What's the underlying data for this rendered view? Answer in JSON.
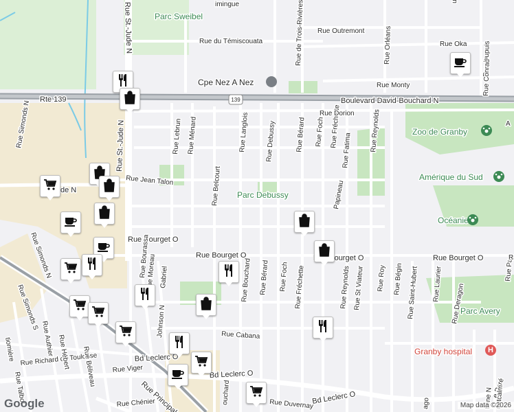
{
  "map": {
    "shields": {
      "route": "139"
    },
    "streets": {
      "rte_139": "Rte 139",
      "boulevard_david_bouchard": "Boulevard David-Bouchard N",
      "rue_bourget_o_left": "Rue Bourget O",
      "rue_bourget_o_mid": "Rue Bourget O",
      "rue_bourget_o_right": "Rue Bourget O",
      "rue_jean_talon": "Rue Jean Talon",
      "rue_cabana": "Rue Cabana",
      "bd_leclerc_o_left": "Bd Leclerc O",
      "bd_leclerc_o_right": "Bd Leclerc O",
      "rue_principale": "Rue Principale",
      "rue_duvernay": "Rue Duvernay",
      "rue_chenier": "Rue Chénier",
      "rue_viger": "Rue Viger",
      "rue_richard_de_toulouse": "Rue Richard de Toulouse",
      "rue_talbot": "Rue Talbot",
      "rue_belouveau": "Rue Béliveau",
      "rue_hebert": "Rue Hébert",
      "rue_authier": "Rue Authier",
      "rue_simonds_n": "Rue Simonds N",
      "rue_simonds_s": "Rue Simonds S",
      "rue_st_jude": "Rue St.-Jude N",
      "rue_st_jude_top": "Rue St.-Jude N",
      "rue_lebrun": "Rue Lebrun",
      "rue_menard": "Rue Ménard",
      "rue_belcourt": "Rue Belcourt",
      "rue_langlois": "Rue Langlois",
      "rue_debussy": "Rue Debussy",
      "rue_berard_top": "Rue Bérard",
      "rue_foch_top": "Rue Foch",
      "rue_frechette_top": "Rue Fréchette",
      "rue_fatima": "Rue Fatima",
      "rue_reynolds_top": "Rue Reynolds",
      "rue_papineau": "Papineau",
      "rue_bouchard": "Rue Bouchard",
      "rue_berard": "Rue Bérard",
      "rue_foch": "Rue Foch",
      "rue_frechette": "Rue Fréchette",
      "rue_reynolds": "Rue Reynolds",
      "rue_st_viateur": "Rue St Viateur",
      "rue_roy": "Rue Roy",
      "rue_begin": "Rue Bégin",
      "rue_saint_hubert": "Rue Saint-Hubert",
      "rue_laurier": "Rue Laurier",
      "rue_deragon": "Rue Deragon",
      "rue_bourassa": "Rue Bourassa",
      "rue_moreau": "Rue Moreau",
      "rue_gabriel": "Gabriel",
      "rue_johnson": "Johnson N",
      "rue_du_temiscouata": "Rue du Témiscouata",
      "rue_outremont": "Rue Outremont",
      "rue_oka": "Rue Oka",
      "rue_monty": "Rue Monty",
      "rue_dorion": "Rue Dorion",
      "rue_de_trois_rivieres": "Rue de Trois-Rivières",
      "rue_orleans": "Rue Orléans",
      "rue_dupuis": "Rue Dupuis",
      "rue_conrad": "Rue Conrad",
      "rue_pare": "e Paré",
      "rue_montcalm": "ontcalm",
      "rue_antoine": "toine N",
      "rue_pa": "Rue Pa",
      "rue_tiomiere": "tiomière",
      "rue_fragment_ue": "ue",
      "rue_fragment_a": "A",
      "rue_fragment_dimingue": "imingue",
      "rue_fragment_n": "N",
      "rue_fragment_de_n": "de N",
      "rue_fragment_ago": "ago",
      "rue_fragment_ra": "Ra",
      "rue_chouard": "ouchard",
      "rue_simonds_top": "Rue Simonds N"
    },
    "places": {
      "parc_sweibel": "Parc Sweibel",
      "parc_debussy": "Parc Debussy",
      "parc_avery": "Parc Avery",
      "cpe_nez_a_nez": "Cpe Nez A Nez",
      "zoo_de_granby": "Zoo de Granby",
      "amerique_du_sud": "Amérique du Sud",
      "oceanie": "Océanie",
      "granby_hospital": "Granby hospital"
    },
    "pins": [
      {
        "icon": "restaurant-icon"
      },
      {
        "icon": "shopping-bag-icon"
      },
      {
        "icon": "shopping-bag-icon"
      },
      {
        "icon": "shopping-cart-icon"
      },
      {
        "icon": "shopping-bag-icon"
      },
      {
        "icon": "shopping-bag-icon"
      },
      {
        "icon": "cafe-icon"
      },
      {
        "icon": "shopping-bag-icon"
      },
      {
        "icon": "shopping-bag-icon"
      },
      {
        "icon": "cafe-icon"
      },
      {
        "icon": "restaurant-icon"
      },
      {
        "icon": "shopping-cart-icon"
      },
      {
        "icon": "restaurant-icon"
      },
      {
        "icon": "shopping-cart-icon"
      },
      {
        "icon": "shopping-cart-icon"
      },
      {
        "icon": "restaurant-icon"
      },
      {
        "icon": "shopping-bag-icon"
      },
      {
        "icon": "shopping-cart-icon"
      },
      {
        "icon": "restaurant-icon"
      },
      {
        "icon": "cafe-icon"
      },
      {
        "icon": "shopping-cart-icon"
      },
      {
        "icon": "shopping-cart-icon"
      },
      {
        "icon": "restaurant-icon"
      }
    ],
    "attribution": {
      "logo": "Google",
      "copyright": "Map data ©2026"
    },
    "colors": {
      "background": "#f1f1f4",
      "road": "#ffffff",
      "highway": "#9aa0a6",
      "park": "#c8e6c0",
      "commercial": "#f2ead3",
      "water": "#7bcbe6",
      "park_text": "#3c8a54",
      "hospital": "#e05a59"
    }
  }
}
